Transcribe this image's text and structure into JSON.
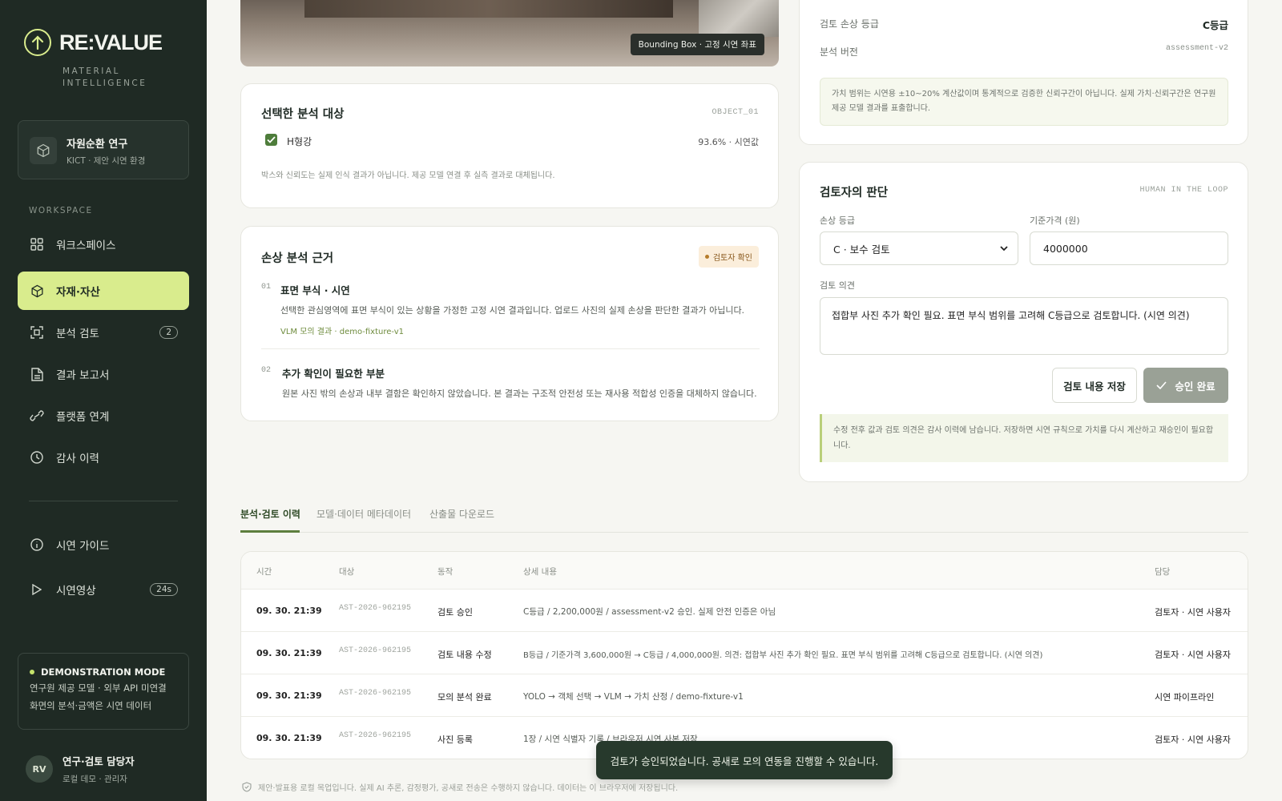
{
  "brand": {
    "name": "RE:VALUE",
    "tagline": "MATERIAL INTELLIGENCE"
  },
  "project": {
    "title": "자원순환 연구",
    "subtitle": "KICT · 제안 시연 환경"
  },
  "sidebar": {
    "section_label": "WORKSPACE",
    "items": [
      {
        "label": "워크스페이스",
        "icon": "grid-icon"
      },
      {
        "label": "자재·자산",
        "icon": "cube-icon",
        "active": true
      },
      {
        "label": "분석 검토",
        "icon": "scan-icon",
        "count": "2"
      },
      {
        "label": "결과 보고서",
        "icon": "document-icon"
      },
      {
        "label": "플랫폼 연계",
        "icon": "link-icon"
      },
      {
        "label": "감사 이력",
        "icon": "clock-icon"
      }
    ],
    "bottom_items": [
      {
        "label": "시연 가이드",
        "icon": "info-icon"
      },
      {
        "label": "시연영상",
        "icon": "play-icon",
        "count": "24s"
      }
    ],
    "demo": {
      "title": "DEMONSTRATION MODE",
      "line1": "연구원 제공 모델 · 외부 API 미연결",
      "line2": "화면의 분석·금액은 시연 데이터"
    },
    "user": {
      "initials": "RV",
      "name": "연구·검토 담당자",
      "role": "로컬 데모 · 관리자"
    }
  },
  "hero": {
    "bbox_label": "Bounding Box · 고정 시연 좌표"
  },
  "selected_target": {
    "title": "선택한 분석 대상",
    "tag": "OBJECT_01",
    "object_name": "H형강",
    "object_value": "93.6% · 시연값",
    "note": "박스와 신뢰도는 실제 인식 결과가 아닙니다. 제공 모델 연결 후 실측 결과로 대체됩니다."
  },
  "damage_basis": {
    "title": "손상 분석 근거",
    "badge": "검토자 확인",
    "steps": [
      {
        "num": "01",
        "title": "표면 부식 · 시연",
        "desc": "선택한 관심영역에 표면 부식이 있는 상황을 가정한 고정 시연 결과입니다. 업로드 사진의 실제 손상을 판단한 결과가 아닙니다.",
        "meta": "VLM 모의 결과 · demo-fixture-v1"
      },
      {
        "num": "02",
        "title": "추가 확인이 필요한 부분",
        "desc": "원본 사진 밖의 손상과 내부 결함은 확인하지 않았습니다. 본 결과는 구조적 안전성 또는 재사용 적합성 인증을 대체하지 않습니다."
      }
    ]
  },
  "assessment": {
    "grade_label": "검토 손상 등급",
    "grade_value": "C등급",
    "version_label": "분석 버전",
    "version_value": "assessment-v2",
    "note": "가치 범위는 시연용 ±10~20% 계산값이며 통계적으로 검증한 신뢰구간이 아닙니다. 실제 가치·신뢰구간은 연구원 제공 모델 결과를 표출합니다."
  },
  "reviewer": {
    "title": "검토자의 판단",
    "tag": "HUMAN IN THE LOOP",
    "grade_label": "손상 등급",
    "grade_value": "C · 보수 검토",
    "price_label": "기준가격 (원)",
    "price_value": "4000000",
    "opinion_label": "검토 의견",
    "opinion_value": "접합부 사진 추가 확인 필요. 표면 부식 범위를 고려해 C등급으로 검토합니다. (시연 의견)",
    "save_button": "검토 내용 저장",
    "approve_button": "승인 완료",
    "audit_note": "수정 전후 값과 검토 의견은 감사 이력에 남습니다. 저장하면 시연 규칙으로 가치를 다시 계산하고 재승인이 필요합니다."
  },
  "tabs": [
    {
      "label": "분석·검토 이력",
      "active": true
    },
    {
      "label": "모델·데이터 메타데이터"
    },
    {
      "label": "산출물 다운로드"
    }
  ],
  "history_table": {
    "headers": {
      "time": "시간",
      "target": "대상",
      "action": "동작",
      "detail": "상세 내용",
      "owner": "담당"
    },
    "rows": [
      {
        "time": "09. 30. 21:39",
        "target": "AST-2026-962195",
        "action": "검토 승인",
        "detail": "C등급 / 2,200,000원 / assessment-v2 승인. 실제 안전 인증은 아님",
        "owner": "검토자 · 시연 사용자"
      },
      {
        "time": "09. 30. 21:39",
        "target": "AST-2026-962195",
        "action": "검토 내용 수정",
        "detail": "B등급 / 기준가격 3,600,000원 → C등급 / 4,000,000원. 의견: 접합부 사진 추가 확인 필요. 표면 부식 범위를 고려해 C등급으로 검토합니다. (시연 의견)",
        "owner": "검토자 · 시연 사용자"
      },
      {
        "time": "09. 30. 21:39",
        "target": "AST-2026-962195",
        "action": "모의 분석 완료",
        "detail": "YOLO → 객체 선택 → VLM → 가치 산정 / demo-fixture-v1",
        "owner": "시연 파이프라인"
      },
      {
        "time": "09. 30. 21:39",
        "target": "AST-2026-962195",
        "action": "사진 등록",
        "detail": "1장 / 시연 식별자 기록 / 브라우저 시연 사본 저장",
        "owner": "검토자 · 시연 사용자"
      }
    ]
  },
  "toast": "검토가 승인되었습니다. 공새로 모의 연동을 진행할 수 있습니다.",
  "footer_note": "제안·발표용 로컬 목업입니다. 실제 AI 추론, 감정평가, 공새로 전송은 수행하지 않습니다. 데이터는 이 브라우저에 저장됩니다.",
  "colors": {
    "sidebar_bg": "#1f2a24",
    "accent": "#d9ec8d",
    "approved_btn": "#9aa196",
    "toast_bg": "#27392c"
  }
}
